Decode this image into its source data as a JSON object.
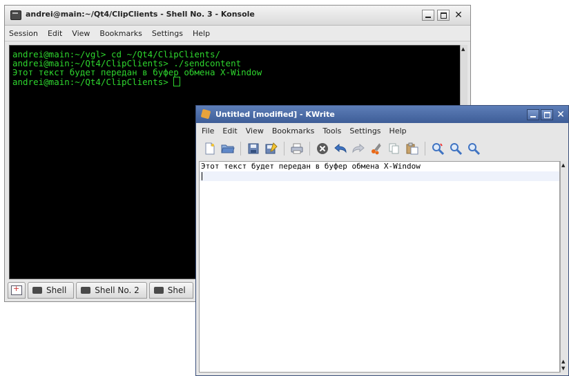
{
  "konsole": {
    "title": "andrei@main:~/Qt4/ClipClients - Shell No. 3 - Konsole",
    "menu": [
      "Session",
      "Edit",
      "View",
      "Bookmarks",
      "Settings",
      "Help"
    ],
    "lines": [
      "andrei@main:~/vgl> cd ~/Qt4/ClipClients/",
      "andrei@main:~/Qt4/ClipClients> ./sendcontent",
      "Этот текст будет передан в буфер обмена X-Window",
      "andrei@main:~/Qt4/ClipClients> "
    ],
    "tabs": [
      "Shell",
      "Shell No. 2",
      "Shel"
    ],
    "colors": {
      "terminal_bg": "#000000",
      "terminal_fg": "#2ed62e"
    }
  },
  "kwrite": {
    "title": "Untitled [modified] - KWrite",
    "menu": [
      "File",
      "Edit",
      "View",
      "Bookmarks",
      "Tools",
      "Settings",
      "Help"
    ],
    "toolbar_icons": [
      "new-document-icon",
      "open-folder-icon",
      "save-icon",
      "save-as-icon",
      "print-icon",
      "close-document-icon",
      "undo-icon",
      "redo-icon",
      "cut-icon",
      "copy-icon",
      "paste-icon",
      "find-icon",
      "zoom-in-icon",
      "zoom-out-icon"
    ],
    "text": "Этот текст будет передан в буфер обмена X-Window",
    "colors": {
      "titlebar": "#4a6aa6"
    }
  }
}
